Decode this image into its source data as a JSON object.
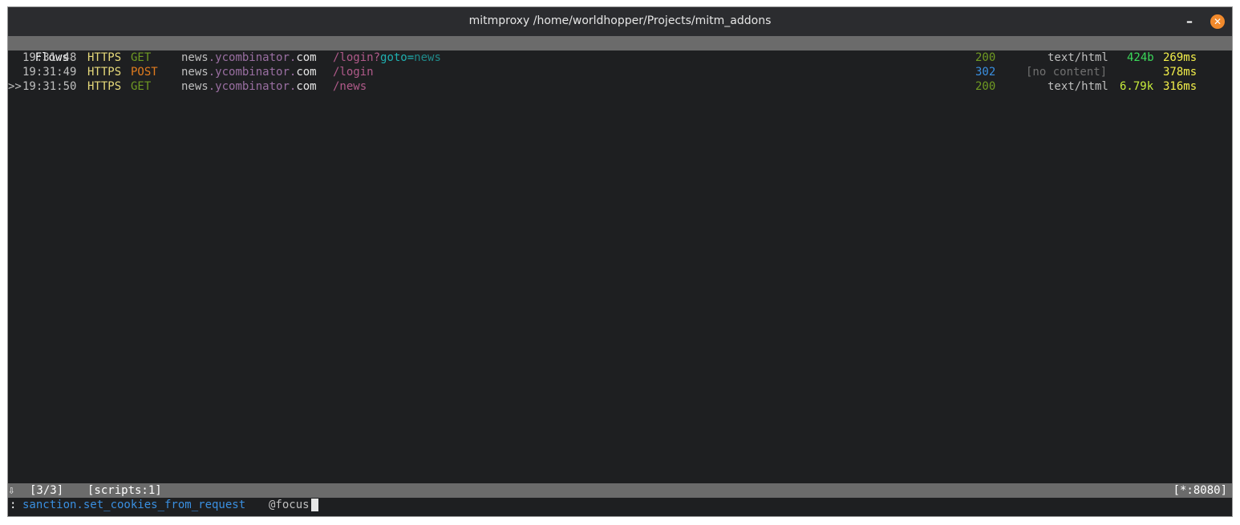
{
  "window": {
    "title": "mitmproxy /home/worldhopper/Projects/mitm_addons",
    "minimize_label": "–",
    "close_label": "✕"
  },
  "header": {
    "label": "Flows"
  },
  "flows": [
    {
      "marker": "",
      "time": "19:31:48",
      "scheme": "HTTPS",
      "method": "GET",
      "host_sub": "news",
      "host_dot1": ".",
      "host_domain": "ycombinator",
      "host_dot2": ".",
      "host_tld": "com",
      "path": "/login",
      "query_q": "?",
      "query_key": "goto",
      "query_eq": "=",
      "query_val": "news",
      "status": "200",
      "content": "text/html",
      "size": "424b",
      "duration": "269ms"
    },
    {
      "marker": "",
      "time": "19:31:49",
      "scheme": "HTTPS",
      "method": "POST",
      "host_sub": "news",
      "host_dot1": ".",
      "host_domain": "ycombinator",
      "host_dot2": ".",
      "host_tld": "com",
      "path": "/login",
      "status": "302",
      "content": "[no content]",
      "size": "",
      "duration": "378ms"
    },
    {
      "marker": ">>",
      "time": "19:31:50",
      "scheme": "HTTPS",
      "method": "GET",
      "host_sub": "news",
      "host_dot1": ".",
      "host_domain": "ycombinator",
      "host_dot2": ".",
      "host_tld": "com",
      "path": "/news",
      "status": "200",
      "content": "text/html",
      "size": "6.79k",
      "duration": "316ms"
    }
  ],
  "status_bar": {
    "arrow": "⇩",
    "position": "[3/3]",
    "scripts": "[scripts:1]",
    "listen": "[*:8080]"
  },
  "command": {
    "prefix": ":",
    "name": "sanction.set_cookies_from_request",
    "arg": "@focus"
  }
}
